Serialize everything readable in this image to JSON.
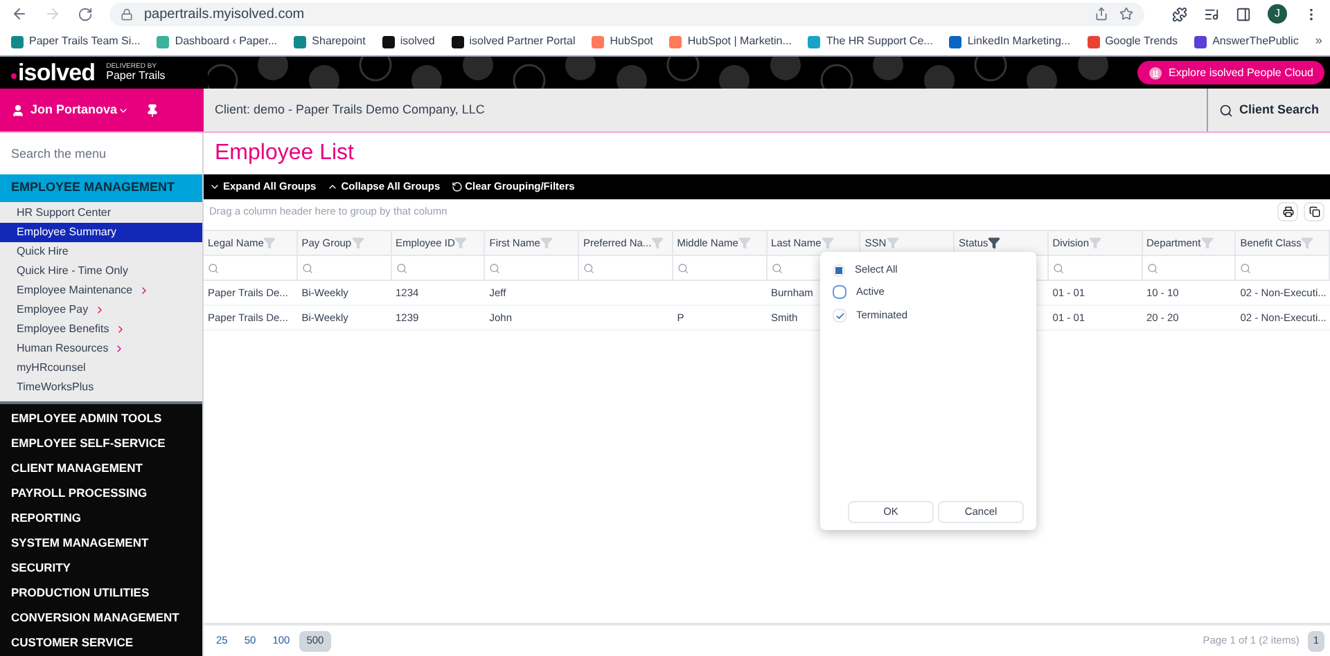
{
  "browser": {
    "url": "papertrails.myisolved.com",
    "avatar": "J",
    "more": "»",
    "bookmarks": [
      "Paper Trails Team Si...",
      "Dashboard ‹ Paper...",
      "Sharepoint",
      "isolved",
      "isolved Partner Portal",
      "HubSpot",
      "HubSpot | Marketin...",
      "The HR Support Ce...",
      "LinkedIn Marketing...",
      "Google Trends",
      "AnswerThePublic"
    ]
  },
  "header": {
    "logo": "isolved",
    "tagline": "DELIVERED BY",
    "partner": "Paper Trails",
    "promo": "Explore isolved People Cloud"
  },
  "user": {
    "name": "Jon Portanova"
  },
  "client": "Client: demo - Paper Trails Demo Company, LLC",
  "client_search": "Client Search",
  "sidebar": {
    "search_placeholder": "Search the menu",
    "section": "EMPLOYEE MANAGEMENT",
    "items": [
      {
        "label": "HR Support Center",
        "selected": false,
        "has_children": false
      },
      {
        "label": "Employee Summary",
        "selected": true,
        "has_children": false
      },
      {
        "label": "Quick Hire",
        "selected": false,
        "has_children": false
      },
      {
        "label": "Quick Hire - Time Only",
        "selected": false,
        "has_children": false
      },
      {
        "label": "Employee Maintenance",
        "selected": false,
        "has_children": true
      },
      {
        "label": "Employee Pay",
        "selected": false,
        "has_children": true
      },
      {
        "label": "Employee Benefits",
        "selected": false,
        "has_children": true
      },
      {
        "label": "Human Resources",
        "selected": false,
        "has_children": true
      },
      {
        "label": "myHRcounsel",
        "selected": false,
        "has_children": false
      },
      {
        "label": "TimeWorksPlus",
        "selected": false,
        "has_children": false
      }
    ],
    "groups": [
      "EMPLOYEE ADMIN TOOLS",
      "EMPLOYEE SELF-SERVICE",
      "CLIENT MANAGEMENT",
      "PAYROLL PROCESSING",
      "REPORTING",
      "SYSTEM MANAGEMENT",
      "SECURITY",
      "PRODUCTION UTILITIES",
      "CONVERSION MANAGEMENT",
      "CUSTOMER SERVICE"
    ]
  },
  "page": {
    "title": "Employee List",
    "group_hint": "Drag a column header here to group by that column",
    "toolbar": [
      {
        "label": "Expand All Groups",
        "kind": "expand"
      },
      {
        "label": "Collapse All Groups",
        "kind": "collapse"
      },
      {
        "label": "Clear Grouping/Filters",
        "kind": "clear"
      }
    ]
  },
  "table": {
    "columns": [
      {
        "label": "Legal Name",
        "filtered": false
      },
      {
        "label": "Pay Group",
        "filtered": false
      },
      {
        "label": "Employee ID",
        "filtered": false
      },
      {
        "label": "First Name",
        "filtered": false
      },
      {
        "label": "Preferred Na...",
        "filtered": false
      },
      {
        "label": "Middle Name",
        "filtered": false
      },
      {
        "label": "Last Name",
        "filtered": false
      },
      {
        "label": "SSN",
        "filtered": false
      },
      {
        "label": "Status",
        "filtered": true
      },
      {
        "label": "Division",
        "filtered": false
      },
      {
        "label": "Department",
        "filtered": false
      },
      {
        "label": "Benefit Class",
        "filtered": false
      }
    ],
    "rows": [
      {
        "cells": [
          "Paper Trails De...",
          "Bi-Weekly",
          "1234",
          "Jeff",
          null,
          null,
          "Burnham",
          null,
          null,
          "01 - 01",
          "10 - 10",
          "02 - Non-Executi..."
        ]
      },
      {
        "cells": [
          "Paper Trails De...",
          "Bi-Weekly",
          "1239",
          "John",
          null,
          "P",
          "Smith",
          null,
          null,
          "01 - 01",
          "20 - 20",
          "02 - Non-Executi..."
        ]
      }
    ]
  },
  "filter_popup": {
    "select_all": {
      "label": "Select All",
      "indeterminate": true
    },
    "options": [
      {
        "label": "Active",
        "checked": false
      },
      {
        "label": "Terminated",
        "checked": true
      }
    ],
    "buttons": [
      "OK",
      "Cancel"
    ]
  },
  "pager": {
    "sizes": [
      {
        "label": "25",
        "selected": false
      },
      {
        "label": "50",
        "selected": false
      },
      {
        "label": "100",
        "selected": false
      },
      {
        "label": "500",
        "selected": true
      }
    ],
    "summary": "Page 1 of 1 (2 items)",
    "pages": [
      {
        "label": "1",
        "selected": true
      }
    ]
  }
}
